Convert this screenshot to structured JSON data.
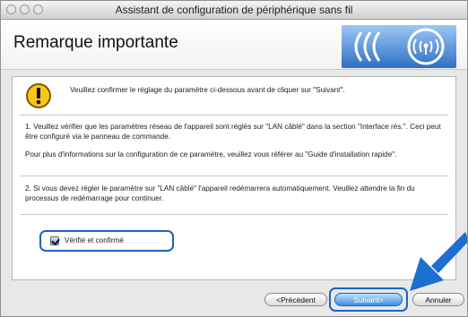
{
  "window": {
    "title": "Assistant de configuration de périphérique sans fil"
  },
  "header": {
    "title": "Remarque importante"
  },
  "content": {
    "warning": "Veuillez confirmer le réglage du paramètre ci-dessous avant de cliquer sur \"Suivant\".",
    "para1": "1. Veuillez vérifier que les paramètres réseau de l'appareil sont réglés sur \"LAN câblé\" dans la section \"Interface rés.\". Ceci peut être configuré via le panneau de commande.",
    "para2": "Pour plus d'informations sur la configuration de ce paramètre, veuillez vous référer au \"Guide d'installation rapide\".",
    "para3": "2. Si vous devez régler le paramètre sur \"LAN câblé\" l'appareil redémarrera automatiquement. Veuillez attendre la fin du processus de redémarrage pour continuer.",
    "checkbox_label": "Vérifié et confirmé",
    "checkbox_checked": true
  },
  "buttons": {
    "previous": "<Précédent",
    "next": "Suivant>",
    "cancel": "Annuler"
  },
  "colors": {
    "accent": "#1b63c8",
    "primary_button": "#3d8fe0",
    "arrow": "#1a6fd1"
  },
  "icons": {
    "warning": "warning-icon",
    "brand_logo": "wireless-logo-icon",
    "pointer": "arrow-icon"
  }
}
